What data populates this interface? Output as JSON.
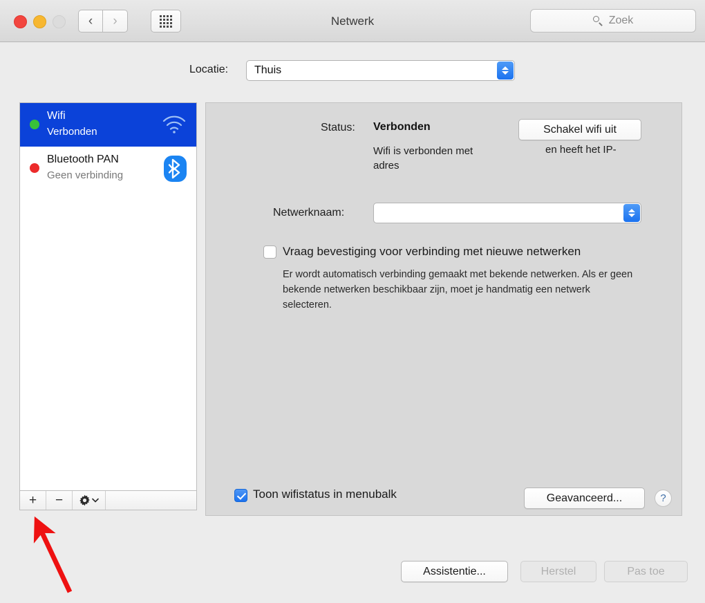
{
  "window": {
    "title": "Netwerk",
    "traffic_lights": [
      "close",
      "minimize",
      "zoom"
    ],
    "nav_back_icon": "chevron-left-icon",
    "nav_forward_icon": "chevron-right-icon",
    "show_all_icon": "grid-icon"
  },
  "search": {
    "placeholder": "Zoek",
    "icon": "search-icon"
  },
  "location": {
    "label": "Locatie:",
    "value": "Thuis"
  },
  "sidebar": {
    "services": [
      {
        "name": "Wifi",
        "status": "Verbonden",
        "status_color": "#38c13a",
        "icon": "wifi-icon",
        "selected": true
      },
      {
        "name": "Bluetooth PAN",
        "status": "Geen verbinding",
        "status_color": "#ec2b2b",
        "icon": "bluetooth-icon",
        "selected": false
      }
    ],
    "toolbar": {
      "add_label": "+",
      "remove_label": "−",
      "action_icon": "gear-icon",
      "action_chevron": "chevron-down-icon"
    }
  },
  "detail": {
    "status_label": "Status:",
    "status_value": "Verbonden",
    "status_description": "Wifi is verbonden met adres",
    "status_description_right": "en heeft het IP-",
    "wifi_toggle_button": "Schakel wifi uit",
    "network_name_label": "Netwerknaam:",
    "network_name_value": "",
    "ask_new_networks_label": "Vraag bevestiging voor verbinding met nieuwe netwerken",
    "ask_new_networks_checked": false,
    "ask_new_networks_description": "Er wordt automatisch verbinding gemaakt met bekende netwerken. Als er geen bekende netwerken beschikbaar zijn, moet je handmatig een netwerk selecteren.",
    "show_status_menubar_label": "Toon wifistatus in menubalk",
    "show_status_menubar_checked": true,
    "advanced_button": "Geavanceerd...",
    "help_button": "?"
  },
  "footer": {
    "assist_button": "Assistentie...",
    "revert_button": "Herstel",
    "apply_button": "Pas toe",
    "revert_disabled": true,
    "apply_disabled": true
  },
  "annotation": {
    "type": "arrow",
    "color": "#ee1111",
    "points_to": "sidebar-add-button"
  }
}
